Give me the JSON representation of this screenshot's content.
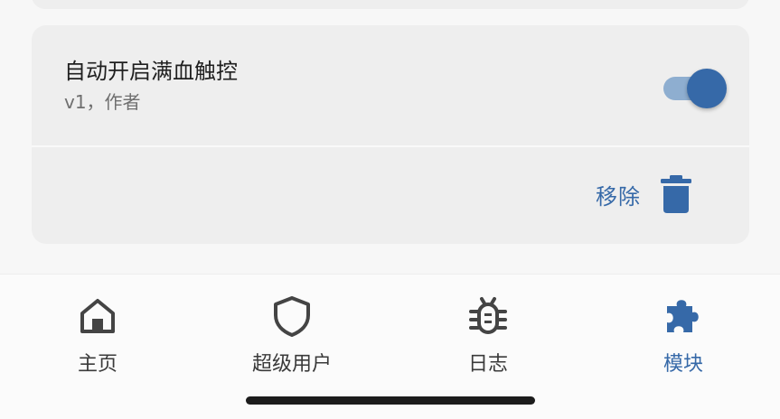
{
  "module": {
    "title": "自动开启满血触控",
    "meta": "v1，作者",
    "enabled": true,
    "remove_label": "移除"
  },
  "icons": {
    "toggle": "toggle-switch",
    "remove": "trash-icon"
  },
  "nav": {
    "items": [
      {
        "label": "主页",
        "icon": "home-icon",
        "active": false
      },
      {
        "label": "超级用户",
        "icon": "shield-icon",
        "active": false
      },
      {
        "label": "日志",
        "icon": "bug-icon",
        "active": false
      },
      {
        "label": "模块",
        "icon": "puzzle-icon",
        "active": true
      }
    ]
  },
  "colors": {
    "accent": "#3669a8",
    "toggle_track": "#8eaed0",
    "card_background": "#eeeeee",
    "page_background": "#f7f7f7",
    "nav_background": "#fbfbfb",
    "nav_icon": "#444444",
    "home_indicator": "#1c1c1c"
  }
}
